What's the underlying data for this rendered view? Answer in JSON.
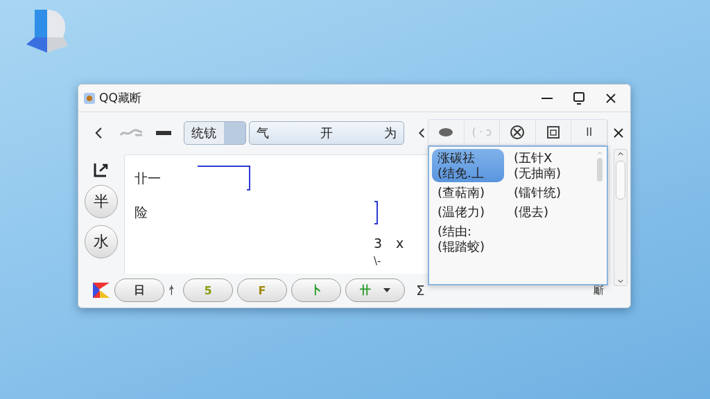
{
  "window": {
    "title": "QQ藏断"
  },
  "toolbar": {
    "segments": [
      {
        "labels": [
          "统铳"
        ],
        "selected": true
      },
      {
        "labels": [
          "气",
          "开",
          "为"
        ],
        "selected": false
      }
    ]
  },
  "side_buttons": [
    {
      "label": "半"
    },
    {
      "label": "水"
    }
  ],
  "editor": {
    "line_1": "卝一",
    "line_2": "险",
    "mark_1": "3",
    "mark_2": "x",
    "mark_3": "\\-"
  },
  "bottom_bar": {
    "buttons": [
      {
        "label": "日",
        "color": "#333333",
        "dropdown": false
      },
      {
        "label": "5",
        "color": "#8a9a10",
        "dropdown": false
      },
      {
        "label": "F",
        "color": "#a08a10",
        "dropdown": false
      },
      {
        "label": "卜",
        "color": "#2a9a2a",
        "dropdown": false
      },
      {
        "label": "卄",
        "color": "#2a9a2a",
        "dropdown": true
      }
    ],
    "divider_label": "忄",
    "trailing_label": "Σ",
    "corner_label": "斸"
  },
  "popup": {
    "tools": [
      {
        "kind": "pill"
      },
      {
        "kind": "text",
        "label": "( · ↄ",
        "disabled": true
      },
      {
        "kind": "blocked"
      },
      {
        "kind": "frame"
      },
      {
        "kind": "text",
        "label": "II",
        "disabled": false
      }
    ],
    "candidates": [
      {
        "text": "涨碳祛\n(结免.丄",
        "selected": true
      },
      {
        "text": "(五针X\n(无抽南)",
        "selected": false
      },
      {
        "text": "(查萜南)",
        "selected": false
      },
      {
        "text": "(镭针统)",
        "selected": false
      },
      {
        "text": "(温佬力)",
        "selected": false
      },
      {
        "text": "(偲去)",
        "selected": false
      },
      {
        "text": "(结由:\n(辊踏蛟)",
        "selected": false
      }
    ]
  }
}
